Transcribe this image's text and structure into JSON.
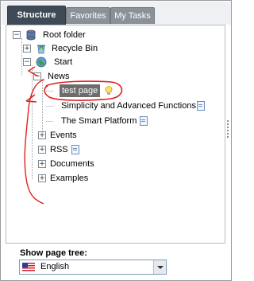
{
  "tabs": [
    {
      "label": "Structure"
    },
    {
      "label": "Favorites"
    },
    {
      "label": "My Tasks"
    }
  ],
  "tree": {
    "root": "Root folder",
    "recycle": "Recycle Bin",
    "start": "Start",
    "news": "News",
    "test_page": "test page",
    "simplicity": "Simplicity and Advanced Functions",
    "smart_platform": "The Smart Platform",
    "events": "Events",
    "rss": "RSS",
    "documents": "Documents",
    "examples": "Examples"
  },
  "footer": {
    "show_label": "Show page tree:",
    "language": "English"
  },
  "colors": {
    "active_tab": "#3e4a55",
    "inactive_tab": "#8a9199",
    "selection": "#6c6c6c",
    "annotation": "#e02020"
  },
  "icons": {
    "tree_toggle_expand": "plus",
    "tree_toggle_collapse": "minus",
    "root": "database",
    "recycle": "recycle-bin",
    "start": "globe",
    "page": "page-document",
    "hint": "lightbulb",
    "flag": "flag-usa"
  }
}
